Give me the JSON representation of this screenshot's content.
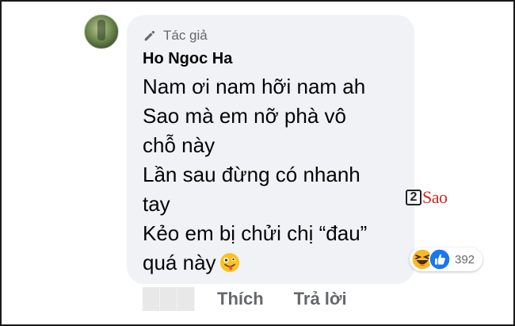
{
  "comment": {
    "author_badge": "Tác giả",
    "author_name": "Ho Ngoc Ha",
    "lines": [
      "Nam ơi nam hỡi nam ah",
      "Sao mà em nỡ phà vô",
      "chỗ này",
      "Lần sau đừng có nhanh",
      "tay",
      "Kẻo em bị chửi chị “đau”",
      "quá này"
    ],
    "trailing_emoji": "zany-face-icon"
  },
  "reactions": {
    "icons": [
      "haha-icon",
      "like-icon"
    ],
    "count": "392"
  },
  "watermark": {
    "number": "2",
    "text": "Sao"
  },
  "actions": {
    "like": "Thích",
    "reply": "Trả lời"
  },
  "colors": {
    "bubble": "#f0f2f5",
    "name": "#050505",
    "meta": "#65676b",
    "like_blue": "#1877f2",
    "haha_yellow": "#f7b928",
    "watermark_red": "#d0271d"
  }
}
